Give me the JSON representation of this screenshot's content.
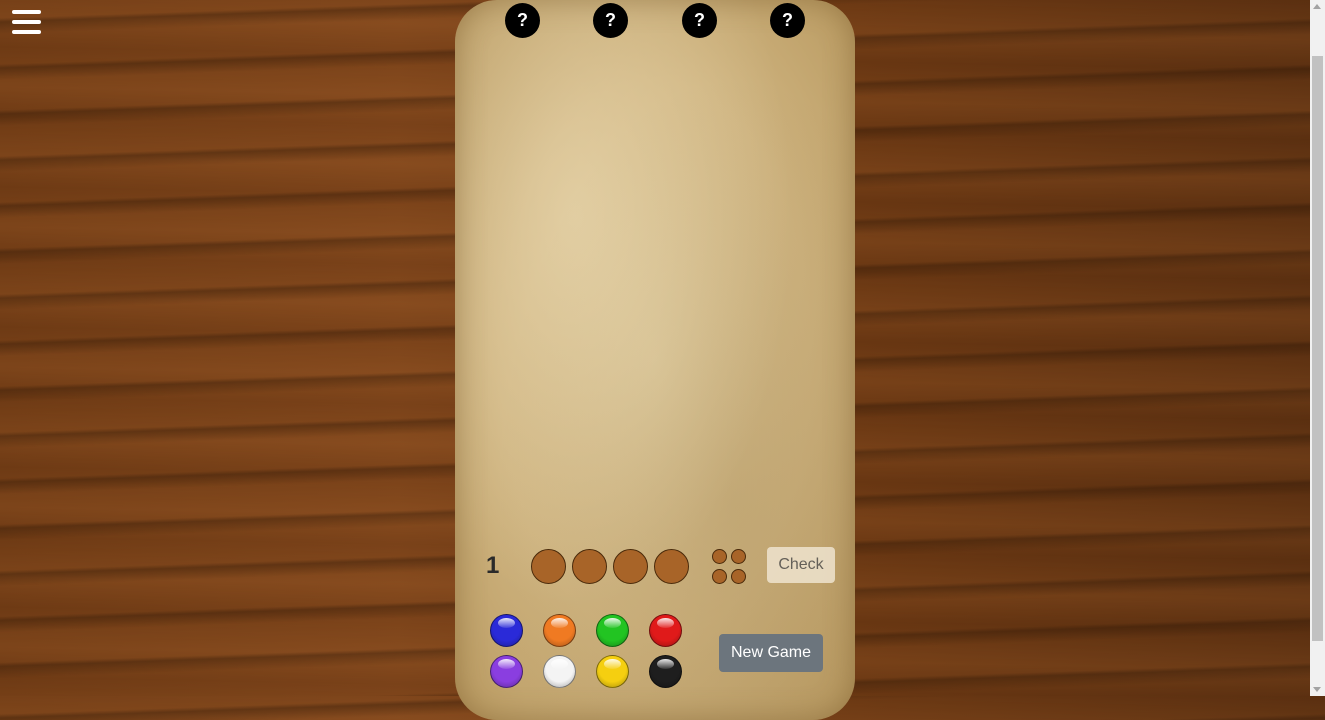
{
  "menu": {
    "icon": "hamburger-icon"
  },
  "secret": {
    "pegs": [
      "?",
      "?",
      "?",
      "?"
    ]
  },
  "current_row": {
    "number": "1",
    "slots": 4,
    "feedback_pegs": 4
  },
  "buttons": {
    "check": "Check",
    "new_game": "New Game"
  },
  "palette": [
    {
      "name": "blue",
      "color": "#2a2ad8"
    },
    {
      "name": "orange",
      "color": "#f07a22"
    },
    {
      "name": "green",
      "color": "#22c422"
    },
    {
      "name": "red",
      "color": "#e01a1a"
    },
    {
      "name": "purple",
      "color": "#8a3ee0"
    },
    {
      "name": "white",
      "color": "#f4f4f4"
    },
    {
      "name": "yellow",
      "color": "#f5cf10"
    },
    {
      "name": "black",
      "color": "#1e1e1e"
    }
  ]
}
